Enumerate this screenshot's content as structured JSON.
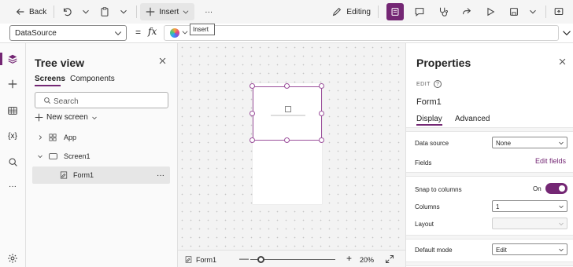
{
  "toolbar": {
    "back_label": "Back",
    "insert_label": "Insert",
    "more_label": "···",
    "editing_label": "Editing"
  },
  "formula_bar": {
    "property": "DataSource",
    "equals": "=",
    "fx": "fx",
    "tooltip": "Insert"
  },
  "tree_view": {
    "title": "Tree view",
    "tabs": [
      "Screens",
      "Components"
    ],
    "search_placeholder": "Search",
    "new_screen_label": "New screen",
    "items": [
      {
        "label": "App"
      },
      {
        "label": "Screen1"
      },
      {
        "label": "Form1",
        "selected": true
      }
    ],
    "more_label": "···"
  },
  "rail": {
    "variables_label": "{x}",
    "more_label": "···"
  },
  "status_bar": {
    "selected_control": "Form1",
    "zoom_minus": "—",
    "zoom_plus": "+",
    "zoom_level": "20%",
    "zoom_value": 0.2
  },
  "properties": {
    "title": "Properties",
    "edit_label": "EDIT",
    "help_glyph": "?",
    "control_name": "Form1",
    "tabs": [
      "Display",
      "Advanced"
    ],
    "rows": {
      "data_source": {
        "label": "Data source",
        "value": "None"
      },
      "fields": {
        "label": "Fields",
        "action": "Edit fields"
      },
      "snap": {
        "label": "Snap to columns",
        "state": "On"
      },
      "columns": {
        "label": "Columns",
        "value": "1"
      },
      "layout": {
        "label": "Layout",
        "value": ""
      },
      "default_mode": {
        "label": "Default mode",
        "value": "Edit"
      }
    }
  },
  "colors": {
    "accent": "#742774",
    "selection": "#9b4f9b",
    "canvas_bg": "#f3f3f3",
    "pane_bg": "#fafafa"
  }
}
